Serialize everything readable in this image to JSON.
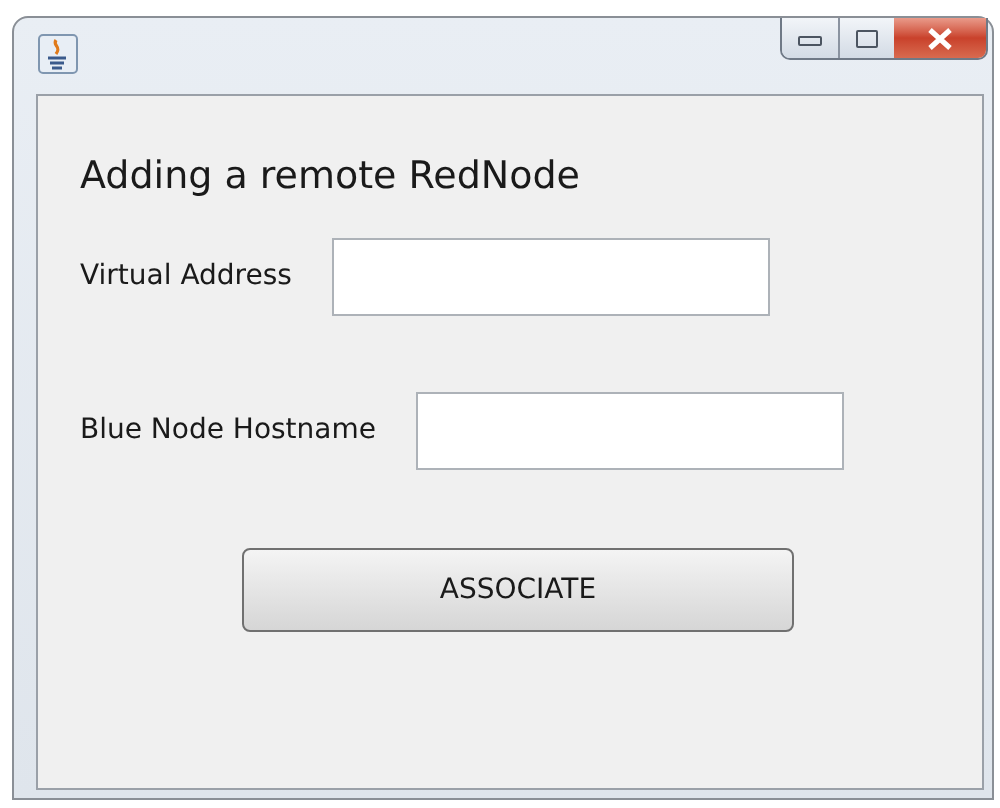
{
  "heading": "Adding a remote RedNode",
  "fields": [
    {
      "label": "Virtual Address"
    },
    {
      "label": "Blue Node Hostname"
    }
  ],
  "button": "ASSOCIATE"
}
